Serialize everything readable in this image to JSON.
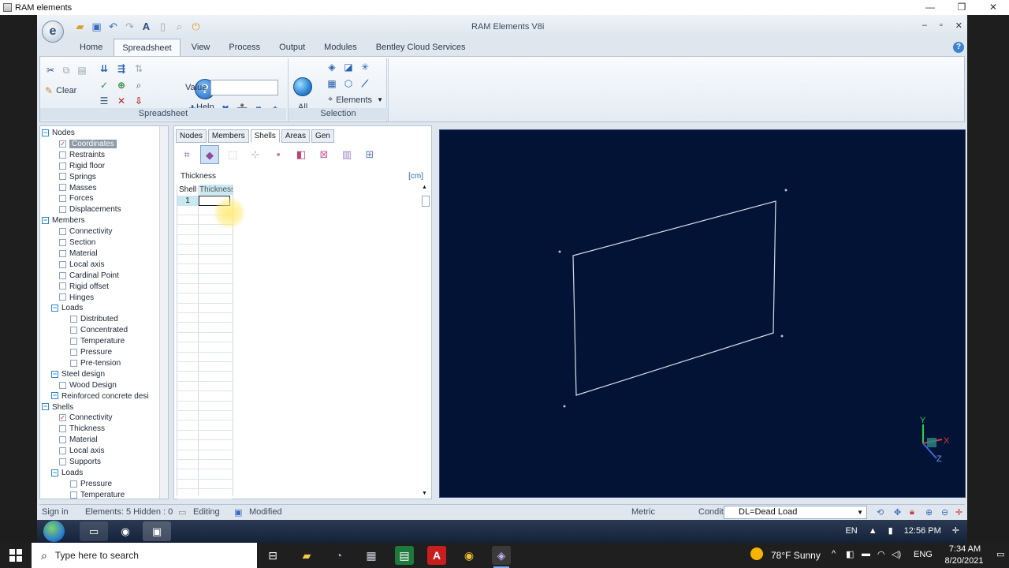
{
  "host_window": {
    "title": "RAM elements",
    "controls": [
      "—",
      "❐",
      "✕"
    ]
  },
  "app": {
    "title": "RAM Elements V8i",
    "logo_letter": "e",
    "window_controls": [
      "–",
      "▫",
      "✕"
    ]
  },
  "menu": {
    "tabs": [
      "Home",
      "Spreadsheet",
      "View",
      "Process",
      "Output",
      "Modules",
      "Bentley Cloud Services"
    ],
    "active": "Spreadsheet"
  },
  "ribbon": {
    "clear_label": "Clear",
    "help_label": "Help",
    "value_label": "Value",
    "value_input": "",
    "spreadsheet_group": "Spreadsheet",
    "all_label": "All",
    "elements_dropdown": "Elements",
    "selection_group": "Selection"
  },
  "tree": {
    "items": [
      {
        "label": "Nodes",
        "kind": "group"
      },
      {
        "label": "Coordinates",
        "kind": "checked",
        "selected": true
      },
      {
        "label": "Restraints",
        "kind": "leaf"
      },
      {
        "label": "Rigid floor",
        "kind": "leaf"
      },
      {
        "label": "Springs",
        "kind": "leaf"
      },
      {
        "label": "Masses",
        "kind": "leaf"
      },
      {
        "label": "Forces",
        "kind": "leaf"
      },
      {
        "label": "Displacements",
        "kind": "leaf"
      },
      {
        "label": "Members",
        "kind": "group"
      },
      {
        "label": "Connectivity",
        "kind": "leaf"
      },
      {
        "label": "Section",
        "kind": "leaf"
      },
      {
        "label": "Material",
        "kind": "leaf"
      },
      {
        "label": "Local axis",
        "kind": "leaf"
      },
      {
        "label": "Cardinal Point",
        "kind": "leaf"
      },
      {
        "label": "Rigid offset",
        "kind": "leaf"
      },
      {
        "label": "Hinges",
        "kind": "leaf"
      },
      {
        "label": "Loads",
        "kind": "subgroup"
      },
      {
        "label": "Distributed",
        "kind": "subleaf"
      },
      {
        "label": "Concentrated",
        "kind": "subleaf"
      },
      {
        "label": "Temperature",
        "kind": "subleaf"
      },
      {
        "label": "Pressure",
        "kind": "subleaf"
      },
      {
        "label": "Pre-tension",
        "kind": "subleaf"
      },
      {
        "label": "Steel design",
        "kind": "subgroup"
      },
      {
        "label": "Wood Design",
        "kind": "leaf"
      },
      {
        "label": "Reinforced concrete desi",
        "kind": "subgroup"
      },
      {
        "label": "Shells",
        "kind": "group"
      },
      {
        "label": "Connectivity",
        "kind": "checked"
      },
      {
        "label": "Thickness",
        "kind": "leaf"
      },
      {
        "label": "Material",
        "kind": "leaf"
      },
      {
        "label": "Local axis",
        "kind": "leaf"
      },
      {
        "label": "Supports",
        "kind": "leaf"
      },
      {
        "label": "Loads",
        "kind": "subgroup"
      },
      {
        "label": "Pressure",
        "kind": "subleaf"
      },
      {
        "label": "Temperature",
        "kind": "subleaf"
      }
    ]
  },
  "sheet": {
    "tabs": [
      "Nodes",
      "Members",
      "Shells",
      "Areas",
      "Gen"
    ],
    "active_tab": "Shells",
    "caption": "Thickness",
    "unit": "[cm]",
    "columns": [
      "Shell",
      "Thickness"
    ],
    "rows": [
      {
        "shell": "1",
        "thickness": ""
      }
    ]
  },
  "viewport": {
    "axis_y": "Y",
    "axis_x": "X",
    "axis_z": "Z",
    "background": "#021336"
  },
  "status": {
    "sign_in": "Sign in",
    "elements": "Elements: 5  Hidden : 0",
    "editing": "Editing",
    "modified": "Modified",
    "metric": "Metric",
    "conditions_label": "Conditions:",
    "conditions_value": "DL=Dead Load"
  },
  "w7_taskbar": {
    "lang": "EN",
    "time": "12:56 PM"
  },
  "taskbar": {
    "search_placeholder": "Type here to search",
    "weather": "78°F  Sunny",
    "lang": "ENG",
    "time": "7:34 AM",
    "date": "8/20/2021"
  }
}
